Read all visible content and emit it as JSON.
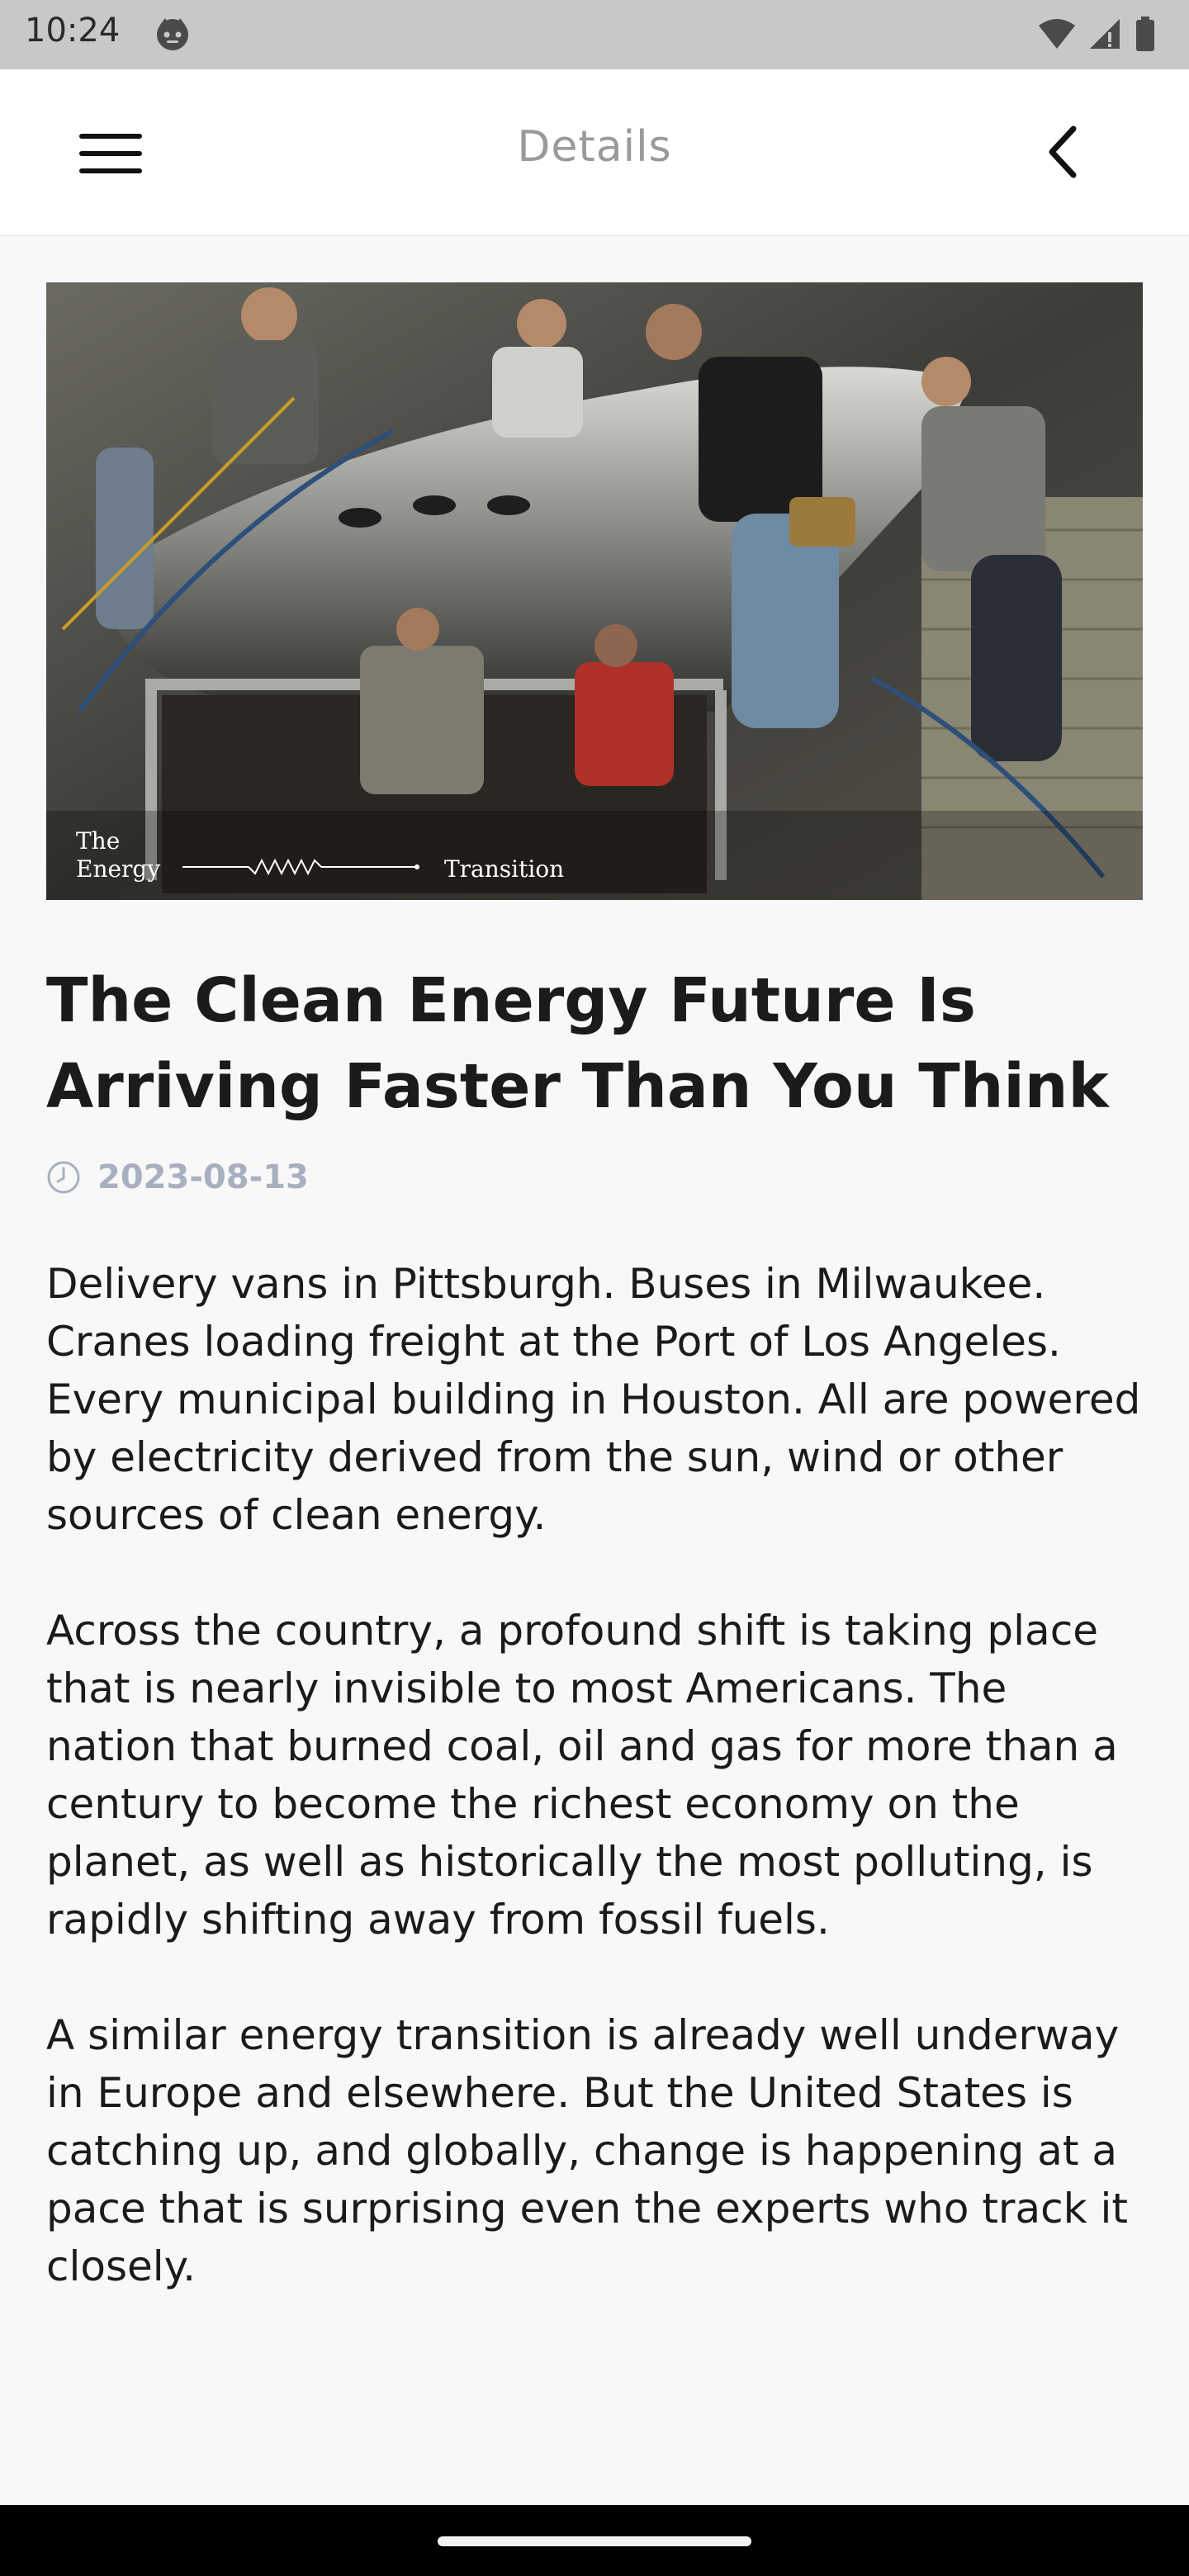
{
  "status_bar": {
    "time": "10:24"
  },
  "header": {
    "title": "Details",
    "menu_icon": "hamburger-menu-icon",
    "back_icon": "chevron-left-icon"
  },
  "hero": {
    "caption_line1": "The",
    "caption_line2": "Energy",
    "caption_right": "Transition"
  },
  "article": {
    "title": "The Clean Energy Future Is Arriving Faster Than You Think",
    "date": "2023-08-13",
    "date_icon": "clock-icon",
    "paragraphs": [
      "Delivery vans in Pittsburgh. Buses in Milwaukee. Cranes loading freight at the Port of Los Angeles. Every municipal building in Houston. All are powered by electricity derived from the sun, wind or other sources of clean energy.",
      "Across the country, a profound shift is taking place that is nearly invisible to most Americans. The nation that burned coal, oil and gas for more than a century to become the richest economy on the planet, as well as historically the most polluting, is rapidly shifting away from fossil fuels.",
      "A similar energy transition is already well underway in Europe and elsewhere. But the United States is catching up, and globally, change is happening at a pace that is surprising even the experts who track it closely."
    ]
  },
  "colors": {
    "status_bar_bg": "#c8c8c8",
    "header_bg": "#ffffff",
    "page_bg": "#f8f8f8",
    "title_text": "#1b1b1b",
    "header_title_text": "#9a9a9a",
    "date_text": "#a7b0bf"
  }
}
